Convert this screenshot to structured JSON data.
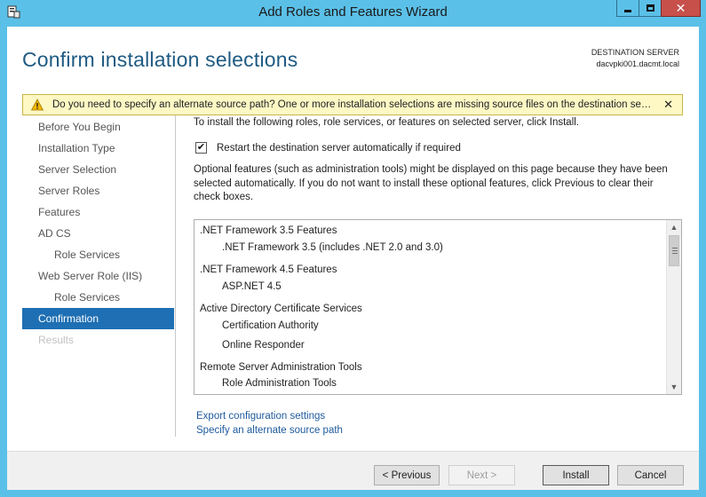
{
  "window": {
    "title": "Add Roles and Features Wizard",
    "minimize_glyph": "",
    "close_glyph": "✕"
  },
  "header": {
    "page_title": "Confirm installation selections",
    "destination_label": "DESTINATION SERVER",
    "destination_server": "dacvpki001.dacmt.local"
  },
  "warning": {
    "text": "Do you need to specify an alternate source path? One or more installation selections are missing source files on the destination server.",
    "close_glyph": "✕",
    "icon": "warning-triangle-icon"
  },
  "nav": {
    "items": [
      {
        "label": "Before You Begin",
        "state": "normal",
        "sub": false
      },
      {
        "label": "Installation Type",
        "state": "normal",
        "sub": false
      },
      {
        "label": "Server Selection",
        "state": "normal",
        "sub": false
      },
      {
        "label": "Server Roles",
        "state": "normal",
        "sub": false
      },
      {
        "label": "Features",
        "state": "normal",
        "sub": false
      },
      {
        "label": "AD CS",
        "state": "normal",
        "sub": false
      },
      {
        "label": "Role Services",
        "state": "normal",
        "sub": true
      },
      {
        "label": "Web Server Role (IIS)",
        "state": "normal",
        "sub": false
      },
      {
        "label": "Role Services",
        "state": "normal",
        "sub": true
      },
      {
        "label": "Confirmation",
        "state": "active",
        "sub": false
      },
      {
        "label": "Results",
        "state": "disabled",
        "sub": false
      }
    ]
  },
  "content": {
    "intro": "To install the following roles, role services, or features on selected server, click Install.",
    "restart_checked": true,
    "restart_label": "Restart the destination server automatically if required",
    "optional_text": "Optional features (such as administration tools) might be displayed on this page because they have been selected automatically. If you do not want to install these optional features, click Previous to clear their check boxes.",
    "features": [
      {
        "label": ".NET Framework 3.5 Features",
        "level": 0
      },
      {
        "label": ".NET Framework 3.5 (includes .NET 2.0 and 3.0)",
        "level": 1
      },
      {
        "label": ".NET Framework 4.5 Features",
        "level": 0
      },
      {
        "label": "ASP.NET 4.5",
        "level": 1
      },
      {
        "label": "Active Directory Certificate Services",
        "level": 0
      },
      {
        "label": "Certification Authority",
        "level": 1
      },
      {
        "label": "Online Responder",
        "level": 1
      },
      {
        "label": "Remote Server Administration Tools",
        "level": 0
      },
      {
        "label": "Role Administration Tools",
        "level": 1
      }
    ],
    "scroll_up_glyph": "▲",
    "scroll_down_glyph": "▼",
    "links": {
      "export": "Export configuration settings",
      "alternate_source": "Specify an alternate source path"
    }
  },
  "buttons": {
    "previous": "< Previous",
    "next": "Next >",
    "install": "Install",
    "cancel": "Cancel"
  },
  "colors": {
    "titlebar": "#5bc0e8",
    "accent": "#1e6fb3",
    "title_text": "#1e5a83",
    "link": "#1e5a9e",
    "warning_bg": "#fdf8c4",
    "close_button": "#c7504b"
  }
}
